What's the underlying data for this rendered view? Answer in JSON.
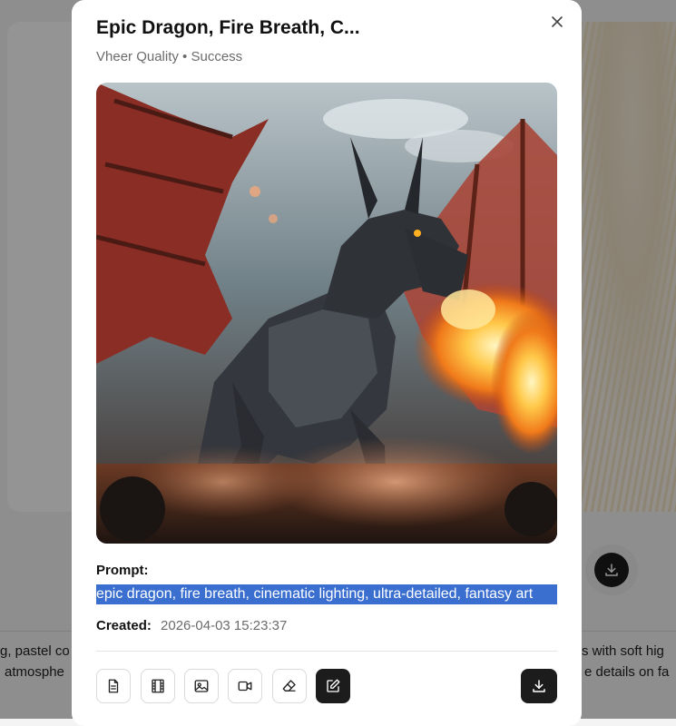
{
  "background": {
    "text_left_line1": "g, pastel co",
    "text_left_line2": "atmosphe",
    "text_right_line1": "s with soft hig",
    "text_right_line2": "e details on fa",
    "download_icon": "download-icon"
  },
  "modal": {
    "title": "Epic Dragon, Fire Breath, C...",
    "subtitle": "Vheer Quality • Success",
    "close_icon": "close-icon",
    "prompt_label": "Prompt:",
    "prompt_text": "epic dragon, fire breath, cinematic lighting, ultra-detailed, fantasy art",
    "created_label": "Created:",
    "created_value": "2026-04-03 15:23:37",
    "toolbar": [
      {
        "icon": "document-icon"
      },
      {
        "icon": "film-icon"
      },
      {
        "icon": "image-icon"
      },
      {
        "icon": "video-camera-icon"
      },
      {
        "icon": "eraser-icon"
      },
      {
        "icon": "edit-icon",
        "active": true
      },
      {
        "icon": "download-icon"
      }
    ]
  },
  "colors": {
    "overlay": "#000000",
    "selection": "#3a6fd0",
    "dark_button": "#1c1c1c"
  }
}
